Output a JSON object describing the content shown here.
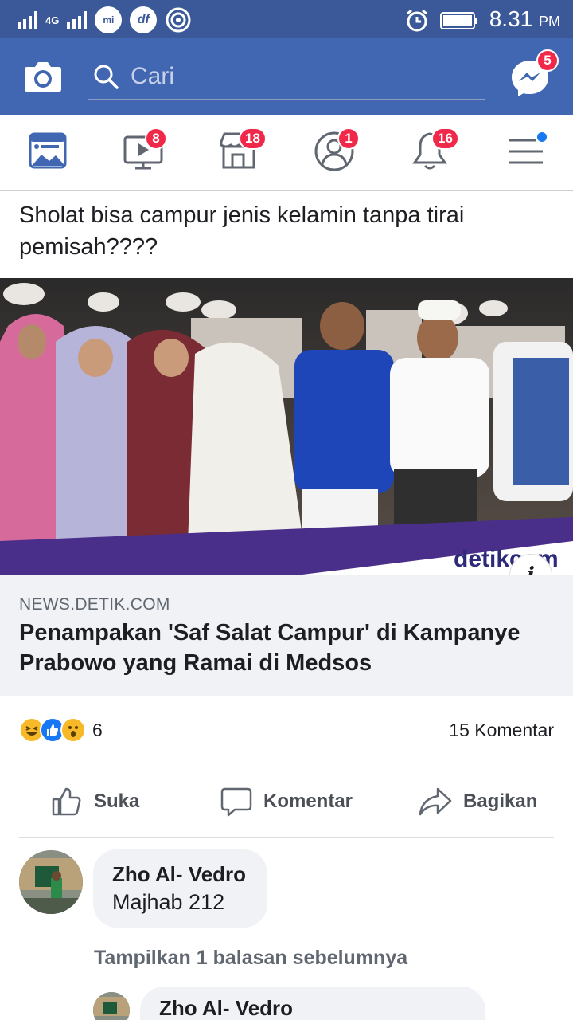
{
  "status_bar": {
    "network_label": "4G",
    "time": "8.31",
    "time_suffix": "PM",
    "mi_label": "mi",
    "df_label": "df"
  },
  "header": {
    "search_placeholder": "Cari",
    "messenger_badge": "5"
  },
  "nav": {
    "video_badge": "8",
    "marketplace_badge": "18",
    "friends_badge": "1",
    "notifications_badge": "16"
  },
  "post": {
    "text": "Sholat bisa campur jenis kelamin tanpa tirai pemisah????",
    "image_watermark": "detikcom",
    "link_domain": "NEWS.DETIK.COM",
    "link_title": "Penampakan 'Saf Salat Campur' di Kampanye Prabowo yang Ramai di Medsos",
    "reaction_count": "6",
    "comment_count": "15 Komentar",
    "reactions": [
      "haha-icon",
      "like-icon",
      "wow-icon"
    ]
  },
  "actions": {
    "like": "Suka",
    "comment": "Komentar",
    "share": "Bagikan"
  },
  "comments": [
    {
      "name": "Zho Al- Vedro",
      "text": "Majhab 212"
    }
  ],
  "replies_link": "Tampilkan 1 balasan sebelumnya",
  "reply": {
    "name": "Zho Al- Vedro"
  },
  "colors": {
    "brand": "#4267b2",
    "status_bar": "#3b5998",
    "badge": "#f02849",
    "link_box_bg": "#f0f2f5"
  }
}
